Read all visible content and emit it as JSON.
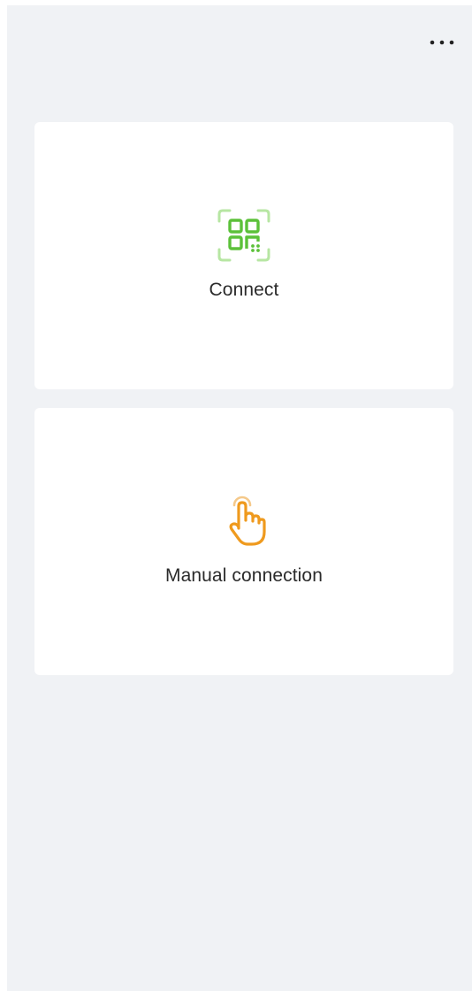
{
  "header": {
    "menu_icon": "more-horizontal-icon"
  },
  "cards": [
    {
      "label": "Connect",
      "icon": "qr-scan-icon",
      "accent": "#6cc644"
    },
    {
      "label": "Manual connection",
      "icon": "hand-tap-icon",
      "accent": "#f0a030"
    }
  ],
  "colors": {
    "background": "#f0f2f5",
    "card": "#ffffff",
    "text": "#2b2b2b"
  }
}
